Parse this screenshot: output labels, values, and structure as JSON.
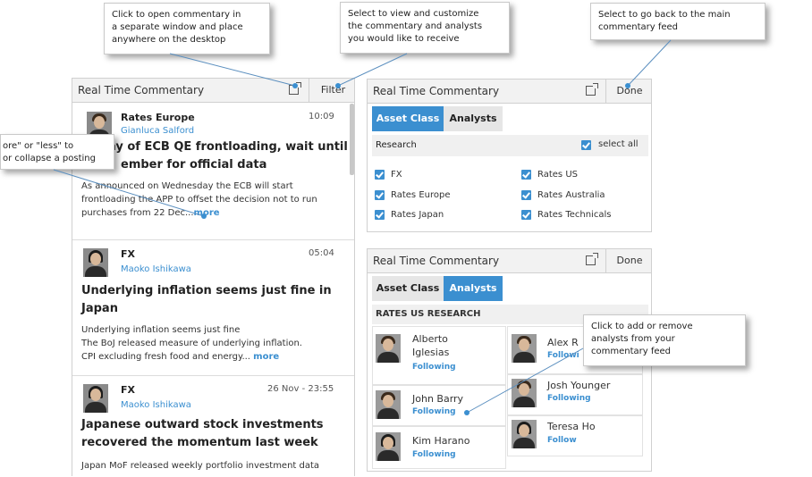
{
  "callouts": {
    "popout": [
      "Click to open commentary in",
      "a separate window and place",
      "anywhere on the desktop"
    ],
    "filter": [
      "Select to view and customize",
      "the commentary and analysts",
      "you would like to receive"
    ],
    "done": [
      "Select to go back to the main",
      "commentary feed"
    ],
    "more": [
      "ore\" or \"less\" to",
      "or collapse a posting"
    ],
    "analysts": [
      "Click to add or remove",
      "analysts from your",
      "commentary feed"
    ]
  },
  "feed": {
    "title": "Real Time Commentary",
    "filter_label": "Filter",
    "items": [
      {
        "category": "Rates Europe",
        "author": "Gianluca Salford",
        "time": "10:09",
        "headline_lines": [
          "ay of ECB QE frontloading, wait until",
          "ember for official data"
        ],
        "body_lines": [
          "As announced on Wednesday the ECB will start",
          "frontloading the APP to offset the decision not to run",
          "purchases from 22 Dec..."
        ],
        "more_label": "more"
      },
      {
        "category": "FX",
        "author": "Maoko Ishikawa",
        "time": "05:04",
        "headline_lines": [
          "Underlying inflation seems just fine in",
          "Japan"
        ],
        "body_lines": [
          "Underlying inflation seems just fine",
          "The BoJ released measure of underlying inflation.",
          "CPI excluding fresh food and energy..."
        ],
        "more_label": "more"
      },
      {
        "category": "FX",
        "author": "Maoko Ishikawa",
        "time": "26 Nov - 23:55",
        "headline_lines": [
          "Japanese outward stock investments",
          "recovered the momentum last week"
        ],
        "body_lines": [
          "Japan MoF released weekly portfolio investment data"
        ],
        "more_label": ""
      }
    ]
  },
  "filter_panel": {
    "title": "Real Time Commentary",
    "done_label": "Done",
    "tabs": [
      "Asset Class",
      "Analysts"
    ],
    "section_label": "Research",
    "select_all_label": "select all",
    "options": [
      "FX",
      "Rates Europe",
      "Rates Japan",
      "Rates US",
      "Rates Australia",
      "Rates Technicals"
    ]
  },
  "analysts_panel": {
    "title": "Real Time Commentary",
    "done_label": "Done",
    "tabs": [
      "Asset Class",
      "Analysts"
    ],
    "section_label": "RATES US RESEARCH",
    "analysts": [
      {
        "name_lines": [
          "Alberto",
          "Iglesias"
        ],
        "status": "Following"
      },
      {
        "name_lines": [
          "John Barry"
        ],
        "status": "Following"
      },
      {
        "name_lines": [
          "Kim Harano"
        ],
        "status": "Following"
      },
      {
        "name_lines": [
          "Alex R"
        ],
        "status": "Followi"
      },
      {
        "name_lines": [
          "Josh Younger"
        ],
        "status": "Following"
      },
      {
        "name_lines": [
          "Teresa Ho"
        ],
        "status": "Follow"
      }
    ]
  },
  "colors": {
    "accent": "#3b8fd0",
    "header": "#f2f2f2"
  }
}
